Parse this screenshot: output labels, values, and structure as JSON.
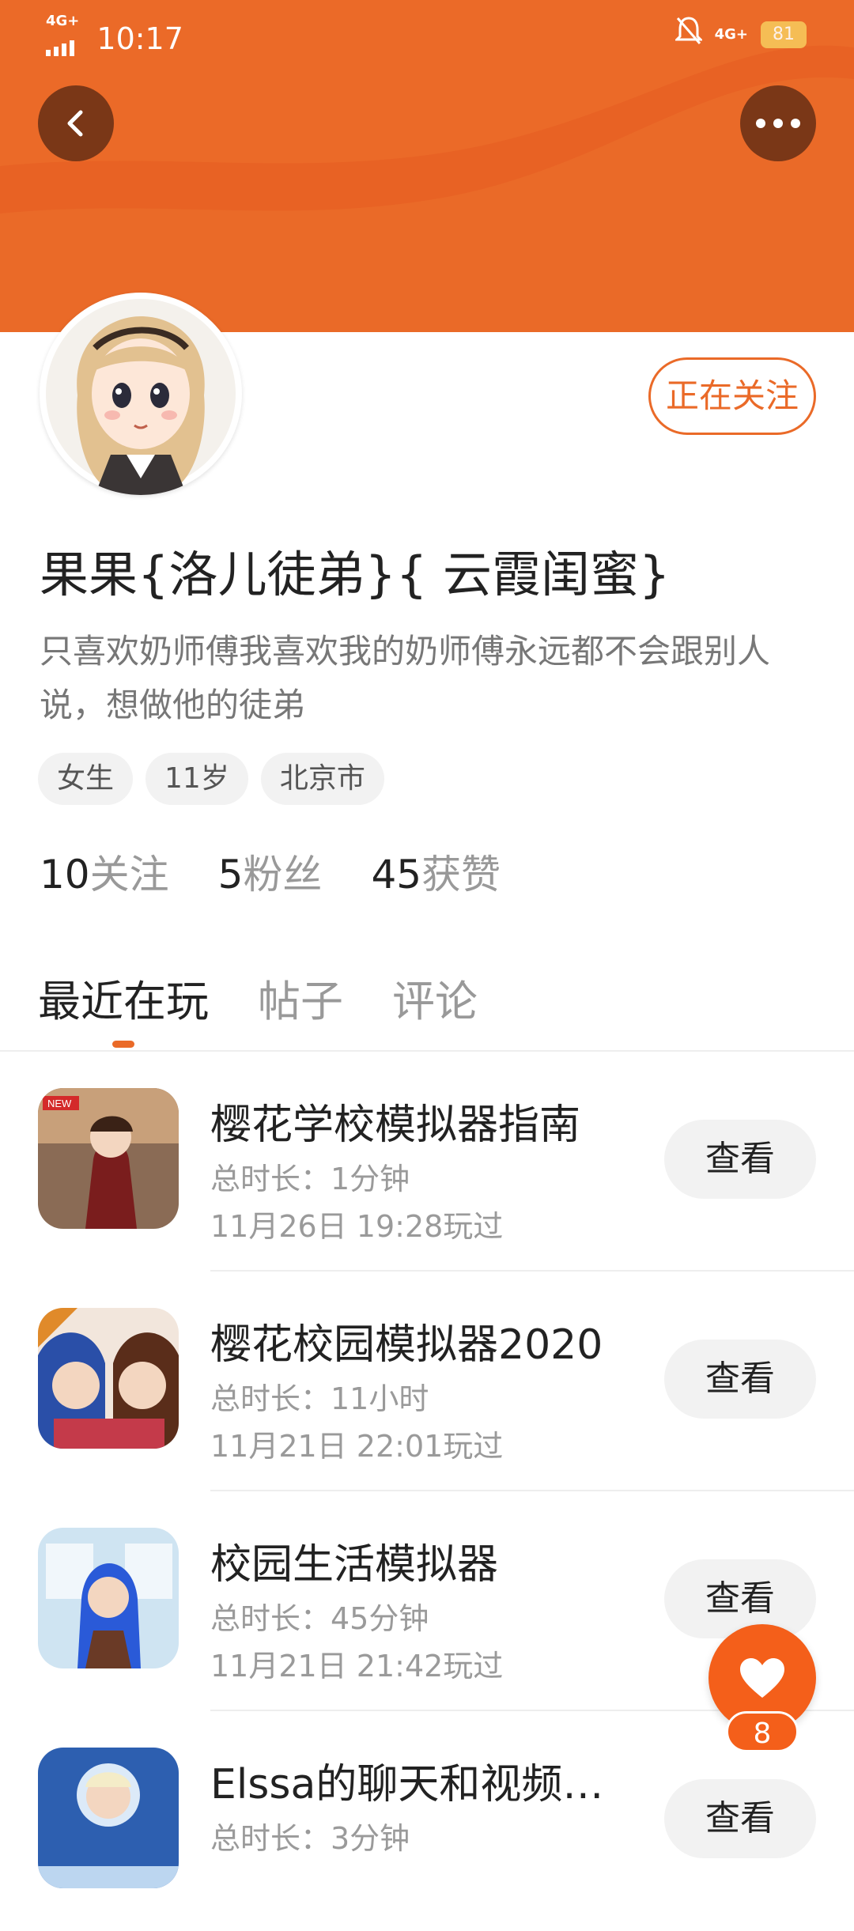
{
  "status_bar": {
    "network_left": "4G+",
    "time": "10:17",
    "network_right": "4G+",
    "battery": "81"
  },
  "header": {
    "back_icon": "chevron-left-icon",
    "more_icon": "more-dots-icon"
  },
  "profile": {
    "follow_label": "正在关注",
    "name": "果果{洛儿徒弟}{ 云霞闺蜜}",
    "bio": "只喜欢奶师傅我喜欢我的奶师傅永远都不会跟别人说，想做他的徒弟",
    "tags": [
      "女生",
      "11岁",
      "北京市"
    ],
    "stats": [
      {
        "num": "10",
        "label": "关注"
      },
      {
        "num": "5",
        "label": "粉丝"
      },
      {
        "num": "45",
        "label": "获赞"
      }
    ]
  },
  "tabs": [
    "最近在玩",
    "帖子",
    "评论"
  ],
  "games": [
    {
      "title": "樱花学校模拟器指南",
      "duration": "总时长：1分钟",
      "last_played": "11月26日 19:28玩过",
      "button": "查看"
    },
    {
      "title": "樱花校园模拟器2020",
      "duration": "总时长：11小时",
      "last_played": "11月21日 22:01玩过",
      "button": "查看"
    },
    {
      "title": "校园生活模拟器",
      "duration": "总时长：45分钟",
      "last_played": "11月21日 21:42玩过",
      "button": "查看"
    },
    {
      "title": "Elssa的聊天和视频…",
      "duration": "总时长：3分钟",
      "last_played": "",
      "button": "查看"
    }
  ],
  "like": {
    "count": "8"
  },
  "colors": {
    "accent": "#ea6a28",
    "header_bg": "#ea6a28"
  }
}
